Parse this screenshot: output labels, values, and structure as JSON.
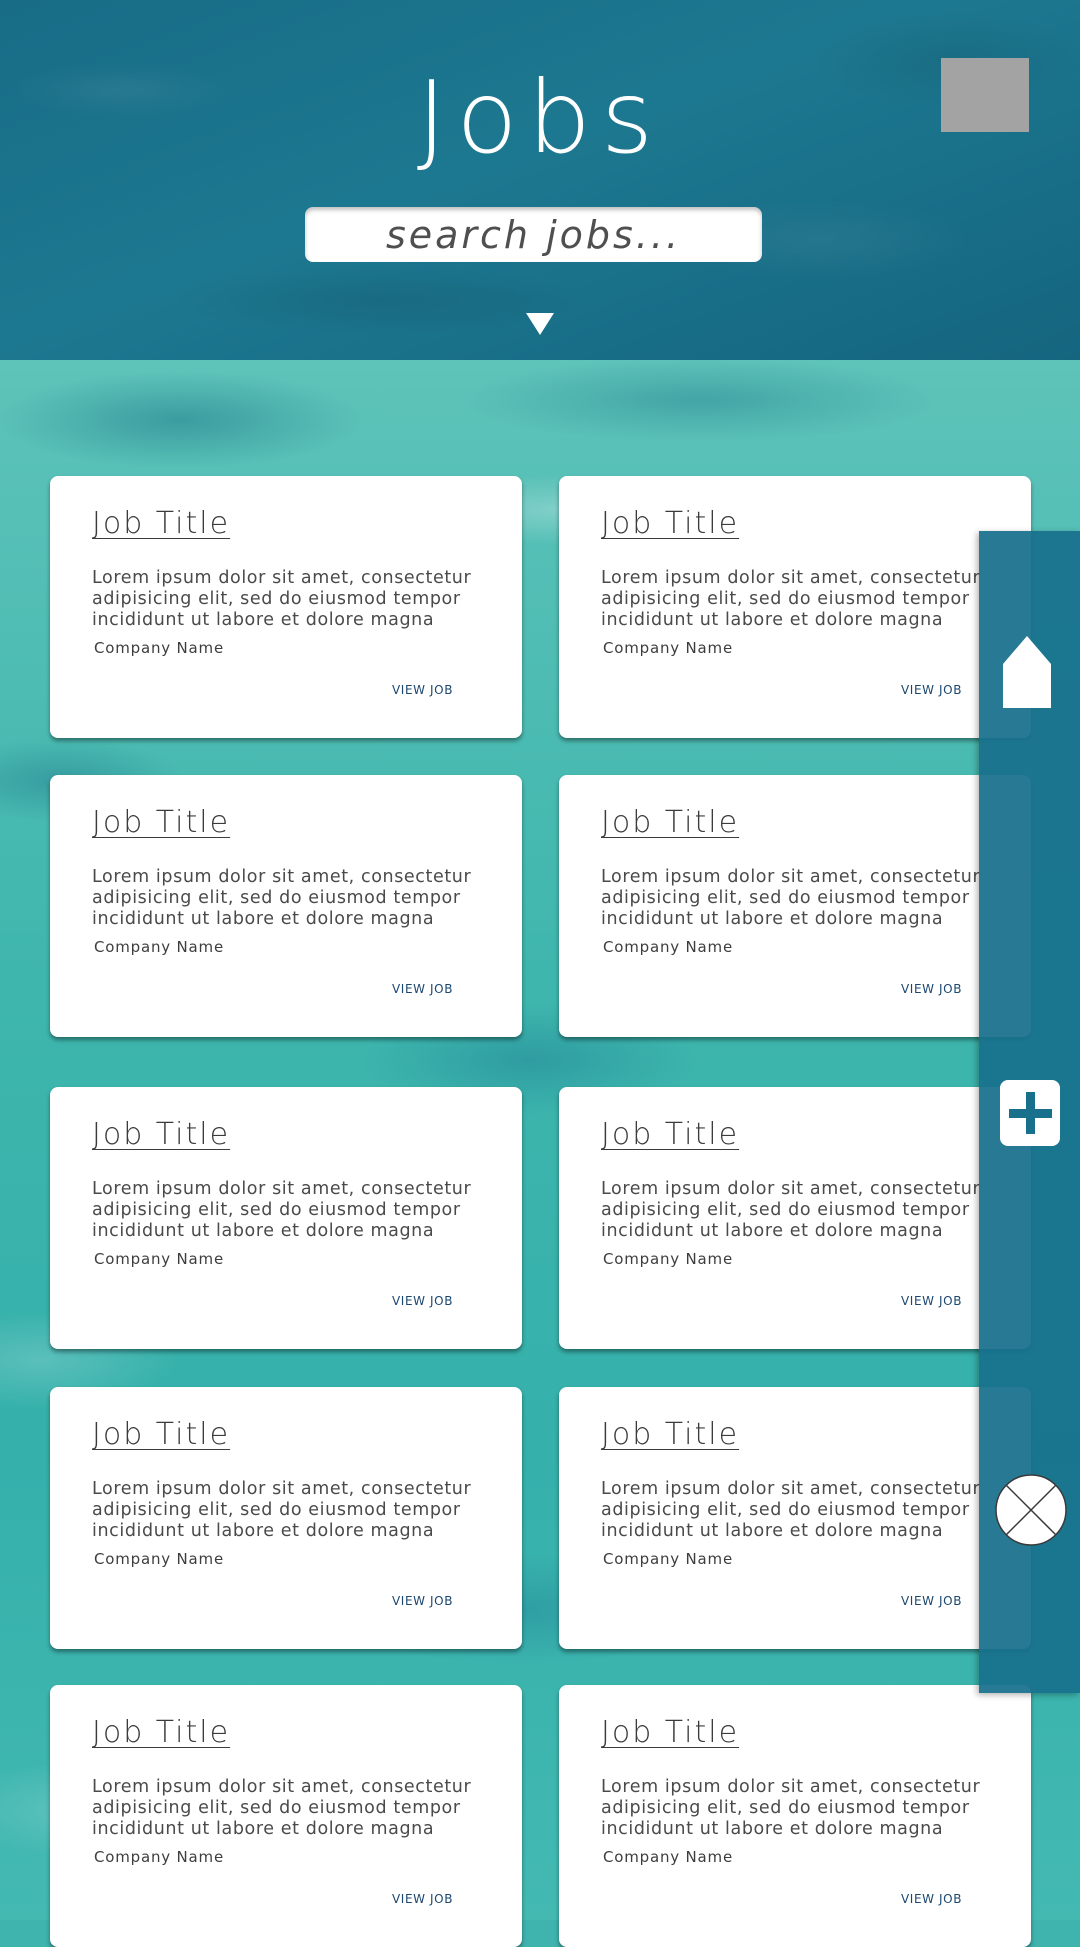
{
  "header": {
    "title": "Jobs",
    "search_placeholder": "search jobs..."
  },
  "icons": {
    "avatar": "avatar-placeholder",
    "expand": "caret-down-icon",
    "home": "home-icon",
    "add": "plus-icon",
    "close": "close-icon"
  },
  "colors": {
    "header_bg": "#1a7089",
    "water_bg": "#3fb3ad",
    "sidebar_bg": "#18708c",
    "link": "#1b4770",
    "avatar": "#a3a3a3"
  },
  "jobs": [
    {
      "title": "Job Title",
      "description": "Lorem ipsum dolor sit amet, consectetur adipisicing elit, sed do eiusmod tempor incididunt ut labore et dolore magna",
      "company": "Company Name",
      "link": "VIEW JOB"
    },
    {
      "title": "Job Title",
      "description": "Lorem ipsum dolor sit amet, consectetur adipisicing elit, sed do eiusmod tempor incididunt ut labore et dolore magna",
      "company": "Company Name",
      "link": "VIEW JOB"
    },
    {
      "title": "Job Title",
      "description": "Lorem ipsum dolor sit amet, consectetur adipisicing elit, sed do eiusmod tempor incididunt ut labore et dolore magna",
      "company": "Company Name",
      "link": "VIEW JOB"
    },
    {
      "title": "Job Title",
      "description": "Lorem ipsum dolor sit amet, consectetur adipisicing elit, sed do eiusmod tempor incididunt ut labore et dolore magna",
      "company": "Company Name",
      "link": "VIEW JOB"
    },
    {
      "title": "Job Title",
      "description": "Lorem ipsum dolor sit amet, consectetur adipisicing elit, sed do eiusmod tempor incididunt ut labore et dolore magna",
      "company": "Company Name",
      "link": "VIEW JOB"
    },
    {
      "title": "Job Title",
      "description": "Lorem ipsum dolor sit amet, consectetur adipisicing elit, sed do eiusmod tempor incididunt ut labore et dolore magna",
      "company": "Company Name",
      "link": "VIEW JOB"
    },
    {
      "title": "Job Title",
      "description": "Lorem ipsum dolor sit amet, consectetur adipisicing elit, sed do eiusmod tempor incididunt ut labore et dolore magna",
      "company": "Company Name",
      "link": "VIEW JOB"
    },
    {
      "title": "Job Title",
      "description": "Lorem ipsum dolor sit amet, consectetur adipisicing elit, sed do eiusmod tempor incididunt ut labore et dolore magna",
      "company": "Company Name",
      "link": "VIEW JOB"
    },
    {
      "title": "Job Title",
      "description": "Lorem ipsum dolor sit amet, consectetur adipisicing elit, sed do eiusmod tempor incididunt ut labore et dolore magna",
      "company": "Company Name",
      "link": "VIEW JOB"
    },
    {
      "title": "Job Title",
      "description": "Lorem ipsum dolor sit amet, consectetur adipisicing elit, sed do eiusmod tempor incididunt ut labore et dolore magna",
      "company": "Company Name",
      "link": "VIEW JOB"
    }
  ]
}
